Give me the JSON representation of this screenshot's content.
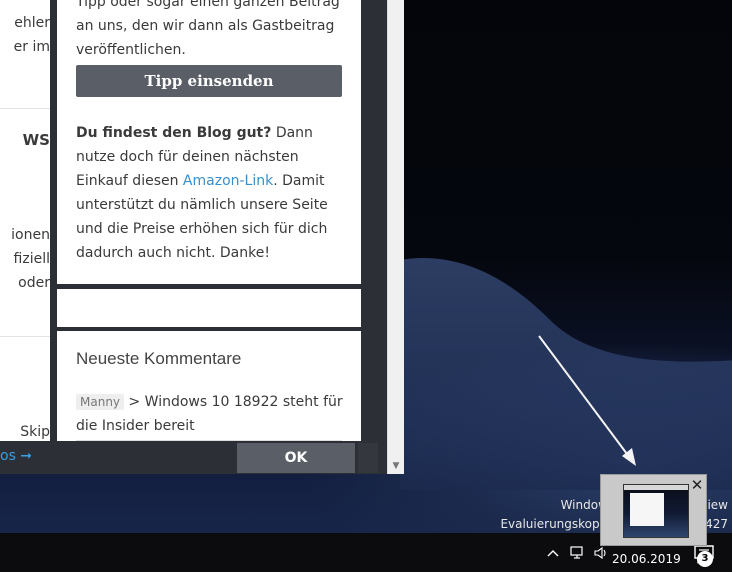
{
  "left_column": {
    "lines": [
      "Tipp oder sogar einen ganzen Beitrag",
      "ehler",
      "er im",
      "WS",
      "ionen",
      "fiziell",
      "oder",
      "Skip"
    ]
  },
  "sidebar": {
    "text_top": "Tipp oder sogar einen ganzen Beitrag an uns, den wir dann als Gastbeitrag veröffentlichen.",
    "tip_button": "Tipp einsenden",
    "promo_bold": "Du findest den Blog gut?",
    "promo_text_1": " Dann nutze doch für deinen nächsten Einkauf diesen ",
    "promo_link": "Amazon-Link",
    "promo_text_2": ". Damit unterstützt du nämlich unsere Seite und die Preise erhöhen sich für dich dadurch auch nicht. Danke!",
    "comments_heading": "Neueste Kommentare",
    "comment_author": "Manny",
    "comment_text": " > Windows 10 18922 steht für die Insider bereit"
  },
  "cookie_bar": {
    "link_text": "os ➞",
    "ok_label": "OK"
  },
  "desktop": {
    "watermark_line1": "Windows 10 Pro for Wor                    iew",
    "watermark_line2": "Evaluierungskopie Build 18922.rs             427"
  },
  "taskbar": {
    "date": "20.06.2019",
    "notification_count": "3"
  },
  "colors": {
    "accent_link": "#3a8fc8",
    "dark_panel": "#2c2f36",
    "button": "#5a5e67"
  }
}
